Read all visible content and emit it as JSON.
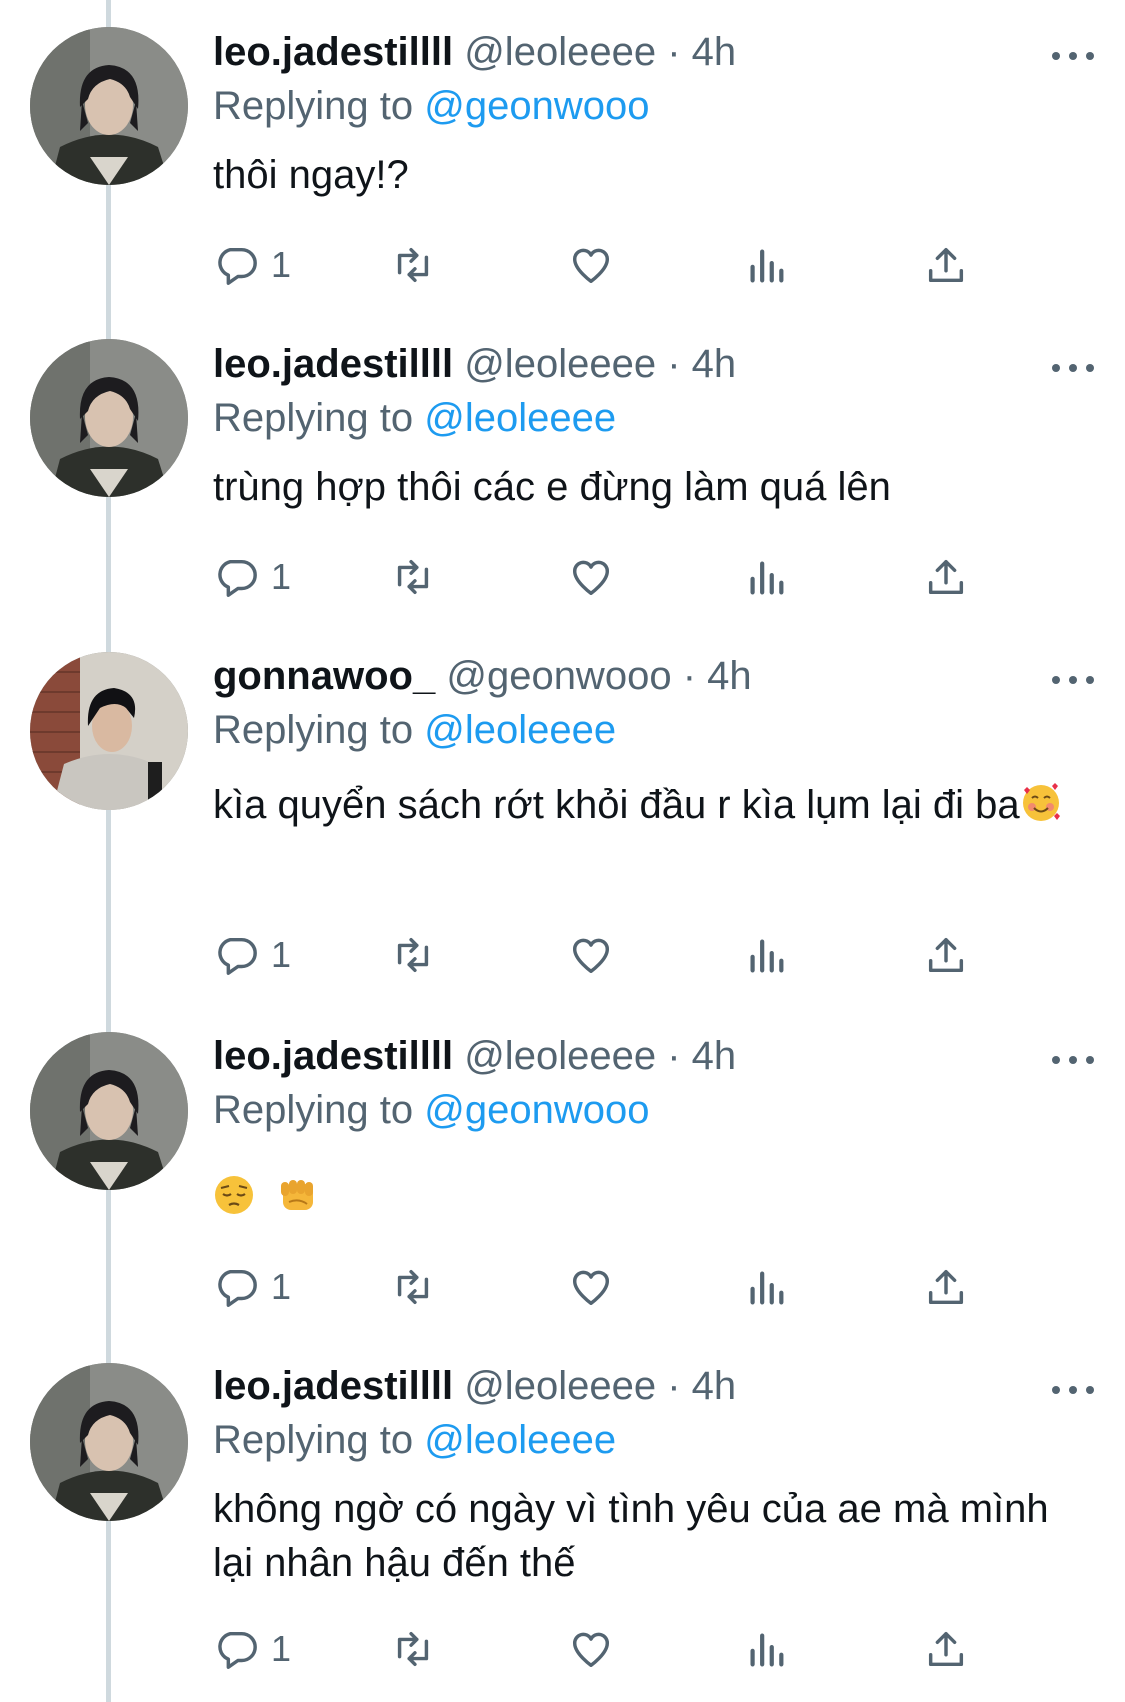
{
  "tweets": [
    {
      "name": "leo.jadestillll",
      "handle": "@leoleeee",
      "dot": "·",
      "time": "4h",
      "replying_prefix": "Replying to",
      "replying_to": "@geonwooo",
      "text": "thôi ngay!?",
      "reply_count": "1",
      "avatar": "person-long-hair-dark-jacket"
    },
    {
      "name": "leo.jadestillll",
      "handle": "@leoleeee",
      "dot": "·",
      "time": "4h",
      "replying_prefix": "Replying to",
      "replying_to": "@leoleeee",
      "text": "trùng hợp thôi các e đừng làm quá lên",
      "reply_count": "1",
      "avatar": "person-long-hair-dark-jacket"
    },
    {
      "name": "gonnawoo_",
      "handle": "@geonwooo",
      "dot": "·",
      "time": "4h",
      "replying_prefix": "Replying to",
      "replying_to": "@leoleeee",
      "text": "kìa quyển sách rớt khỏi đầu r kìa lụm lại đi ba",
      "emoji_after_text": "smiling-face-with-hearts",
      "reply_count": "1",
      "avatar": "person-grey-hoodie-brick-wall"
    },
    {
      "name": "leo.jadestillll",
      "handle": "@leoleeee",
      "dot": "·",
      "time": "4h",
      "replying_prefix": "Replying to",
      "replying_to": "@geonwooo",
      "emoji_only": [
        "pensive-face",
        "fist-bump"
      ],
      "reply_count": "1",
      "avatar": "person-long-hair-dark-jacket"
    },
    {
      "name": "leo.jadestillll",
      "handle": "@leoleeee",
      "dot": "·",
      "time": "4h",
      "replying_prefix": "Replying to",
      "replying_to": "@leoleeee",
      "text": "không ngờ có ngày vì tình yêu của ae mà mình lại nhân hậu đến thế",
      "reply_count": "1",
      "avatar": "person-long-hair-dark-jacket"
    }
  ],
  "icons": {
    "reply": "reply-bubble-icon",
    "retweet": "retweet-icon",
    "like": "heart-icon",
    "views": "views-bar-chart-icon",
    "share": "share-upload-icon",
    "more": "more-dots-icon"
  },
  "colors": {
    "text": "#0f1419",
    "secondary": "#536471",
    "mention": "#1d9bf0",
    "thread_line": "#cfd9de"
  }
}
